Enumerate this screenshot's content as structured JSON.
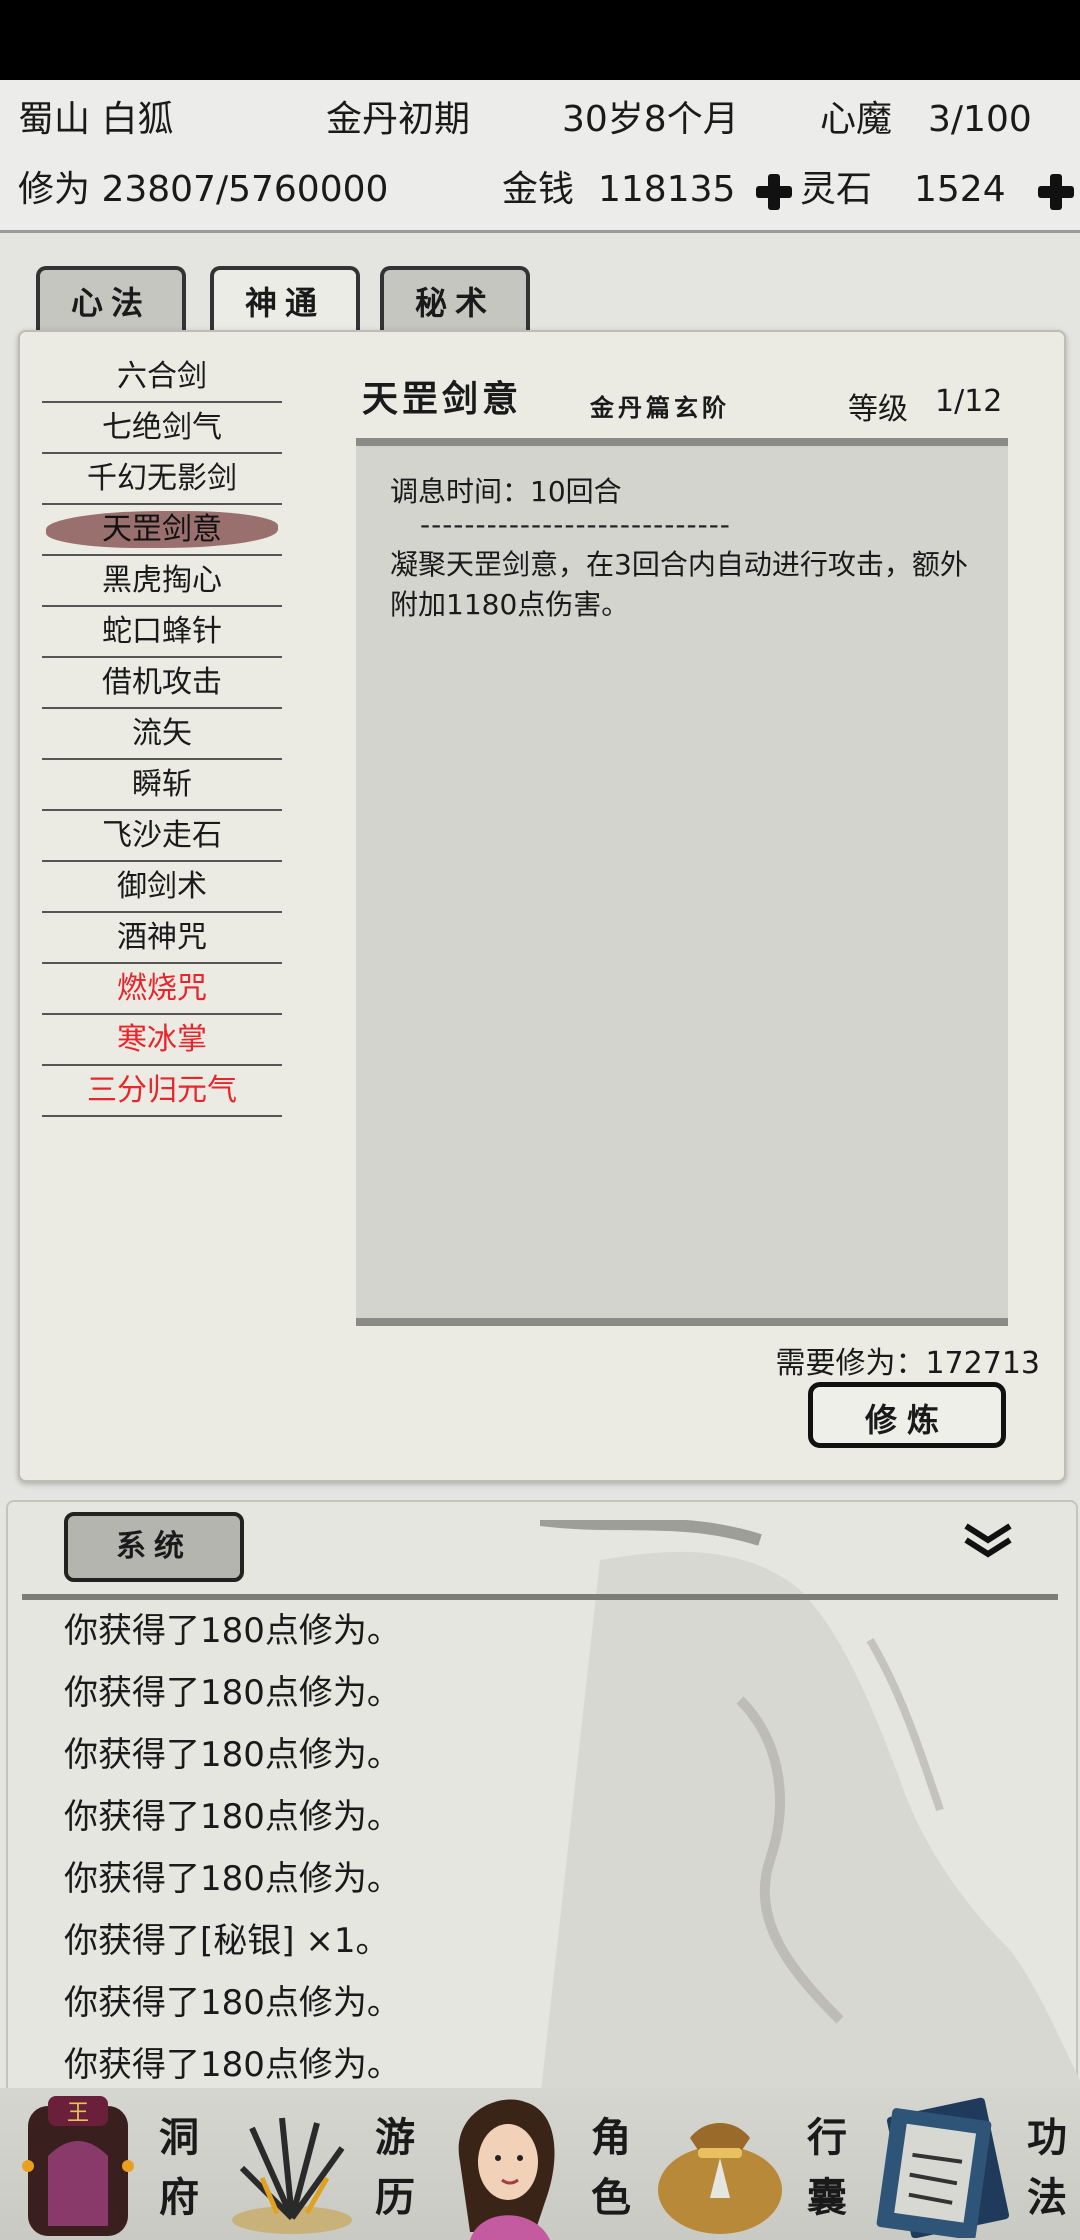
{
  "header": {
    "sect_name": "蜀山 白狐",
    "realm": "金丹初期",
    "age": "30岁8个月",
    "demon_label": "心魔",
    "demon_value": "3/100",
    "cultivation": "修为 23807/5760000",
    "money_label": "金钱",
    "money_value": "118135",
    "spirit_label": "灵石",
    "spirit_value": "1524",
    "plus_icon": "plus-icon"
  },
  "tabs": [
    {
      "label": "心法",
      "state": "inactive"
    },
    {
      "label": "神通",
      "state": "active"
    },
    {
      "label": "秘术",
      "state": "inactive"
    }
  ],
  "skills": [
    {
      "name": "六合剑",
      "color": "#1a1a1a"
    },
    {
      "name": "七绝剑气",
      "color": "#1a1a1a"
    },
    {
      "name": "千幻无影剑",
      "color": "#1a1a1a"
    },
    {
      "name": "天罡剑意",
      "color": "#1a1a1a",
      "selected": true
    },
    {
      "name": "黑虎掏心",
      "color": "#1a1a1a"
    },
    {
      "name": "蛇口蜂针",
      "color": "#1a1a1a"
    },
    {
      "name": "借机攻击",
      "color": "#1a1a1a"
    },
    {
      "name": "流矢",
      "color": "#1a1a1a"
    },
    {
      "name": "瞬斩",
      "color": "#1a1a1a"
    },
    {
      "name": "飞沙走石",
      "color": "#1a1a1a"
    },
    {
      "name": "御剑术",
      "color": "#1a1a1a"
    },
    {
      "name": "酒神咒",
      "color": "#1a1a1a"
    },
    {
      "name": "燃烧咒",
      "color": "#e8252a"
    },
    {
      "name": "寒冰掌",
      "color": "#e8252a"
    },
    {
      "name": "三分归元气",
      "color": "#e8252a"
    }
  ],
  "detail": {
    "title": "天罡剑意",
    "subtitle": "金丹篇玄阶",
    "level_label": "等级",
    "level_value": "1/12",
    "rest_time": "调息时间：10回合",
    "divider": "----------------------------",
    "description": "凝聚天罡剑意，在3回合内自动进行攻击，额外附加1180点伤害。",
    "required": "需要修为：172713",
    "train_button": "修炼"
  },
  "system": {
    "tab_label": "系统",
    "collapse_icon": "double-chevron-down-icon",
    "messages": [
      "你获得了180点修为。",
      "你获得了180点修为。",
      "你获得了180点修为。",
      "你获得了180点修为。",
      "你获得了180点修为。",
      "你获得了[秘银] ×1。",
      "你获得了180点修为。",
      "你获得了180点修为。"
    ]
  },
  "nav": [
    {
      "label": "洞府",
      "icon": "cave-dwelling-icon"
    },
    {
      "label": "游历",
      "icon": "wandering-grass-icon"
    },
    {
      "label": "角色",
      "icon": "character-portrait-icon"
    },
    {
      "label": "行囊",
      "icon": "travel-bag-icon"
    },
    {
      "label": "功法",
      "icon": "technique-book-icon"
    }
  ],
  "colors": {
    "selected_brush": "#8c5a5a",
    "red_skill": "#e8252a",
    "panel_bg": "#ebebe4"
  }
}
